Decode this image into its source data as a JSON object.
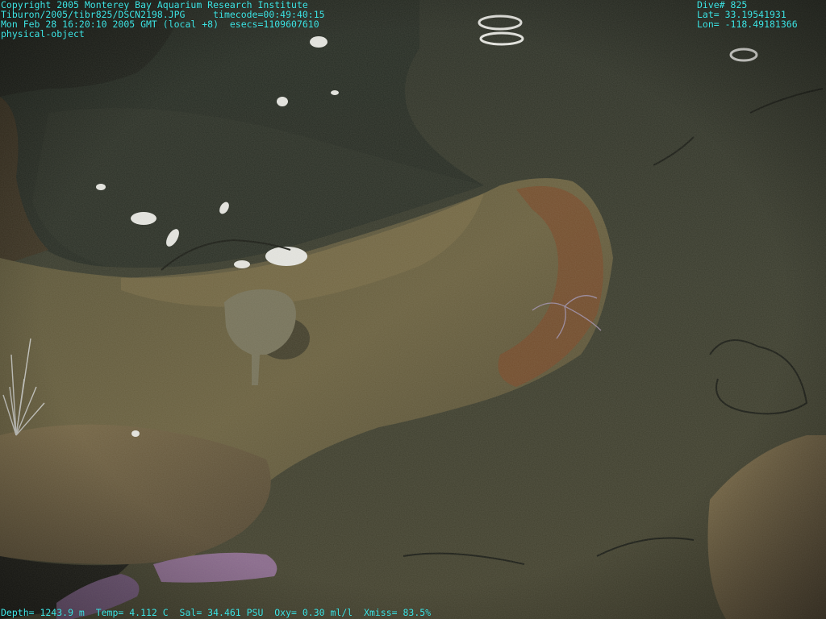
{
  "overlay": {
    "top_left": [
      "Copyright 2005 Monterey Bay Aquarium Research Institute",
      "Tiburon/2005/tibr825/DSCN2198.JPG     timecode=00:49:40:15",
      "Mon Feb 28 16:20:10 2005 GMT (local +8)  esecs=1109607610",
      "physical-object"
    ],
    "top_right": [
      "Dive# 825",
      "Lat= 33.19541931",
      "Lon= -118.49181366"
    ],
    "bottom": "Depth= 1243.9 m  Temp= 4.112 C  Sal= 34.461 PSU  Oxy= 0.30 ml/l  Xmiss= 83.5%",
    "text_color": "#3ee6e6"
  },
  "scene": {
    "description_colors": {
      "sediment": "#3b3d2f",
      "pit_shadow": "#262a22",
      "crust": "#5c5337",
      "crust_highlight": "#7d6f49",
      "rust": "#7a4a2a",
      "sea_star": "#8a6a8e",
      "sponge": "#77735b",
      "shell": "#e6e6e2"
    }
  }
}
